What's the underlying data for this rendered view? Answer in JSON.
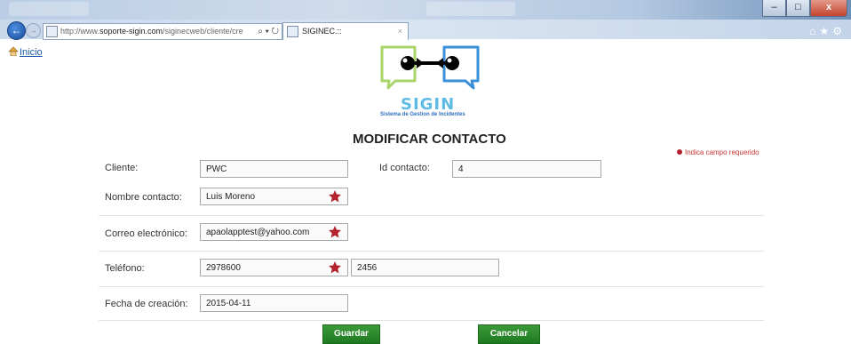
{
  "browser": {
    "url_prefix": "http://www.",
    "url_domain": "soporte-sigin.com",
    "url_rest": "/siginecweb/cliente/cre",
    "addr_tools": "⌕ ▾ ↻",
    "tab_title": "SIGINEC.::",
    "tab_close": "×",
    "minimize": "–",
    "maximize": "□",
    "close": "x",
    "back": "←",
    "forward": "→",
    "right_icons": "⌂★⚙"
  },
  "nav": {
    "home_label": "Inicio"
  },
  "logo": {
    "title": "SIGIN",
    "subtitle": "Sistema de Gestion de Incidentes"
  },
  "page": {
    "title": "MODIFICAR CONTACTO",
    "required_note": "Indica campo requerido"
  },
  "form": {
    "cliente": {
      "label": "Cliente:",
      "value": "PWC"
    },
    "id_contacto": {
      "label": "Id contacto:",
      "value": "4"
    },
    "nombre": {
      "label": "Nombre contacto:",
      "value": "Luis Moreno",
      "required": true
    },
    "correo": {
      "label": "Correo electrónico:",
      "value": "apaolapptest@yahoo.com",
      "required": true
    },
    "telefono": {
      "label": "Teléfono:",
      "value": "2978600",
      "extension": "2456",
      "required": true
    },
    "fecha": {
      "label": "Fecha de creación:",
      "value": "2015-04-11"
    }
  },
  "actions": {
    "save": "Guardar",
    "cancel": "Cancelar"
  },
  "colors": {
    "button_green": "#2a8a2c",
    "required_red": "#b3222d",
    "logo_green": "#a9d46a",
    "logo_blue": "#3b8ed8"
  },
  "icons": [
    "back-arrow-icon",
    "forward-arrow-icon",
    "page-favicon-icon",
    "home-icon",
    "required-star-icon",
    "favorites-star-icon",
    "settings-gear-icon"
  ]
}
